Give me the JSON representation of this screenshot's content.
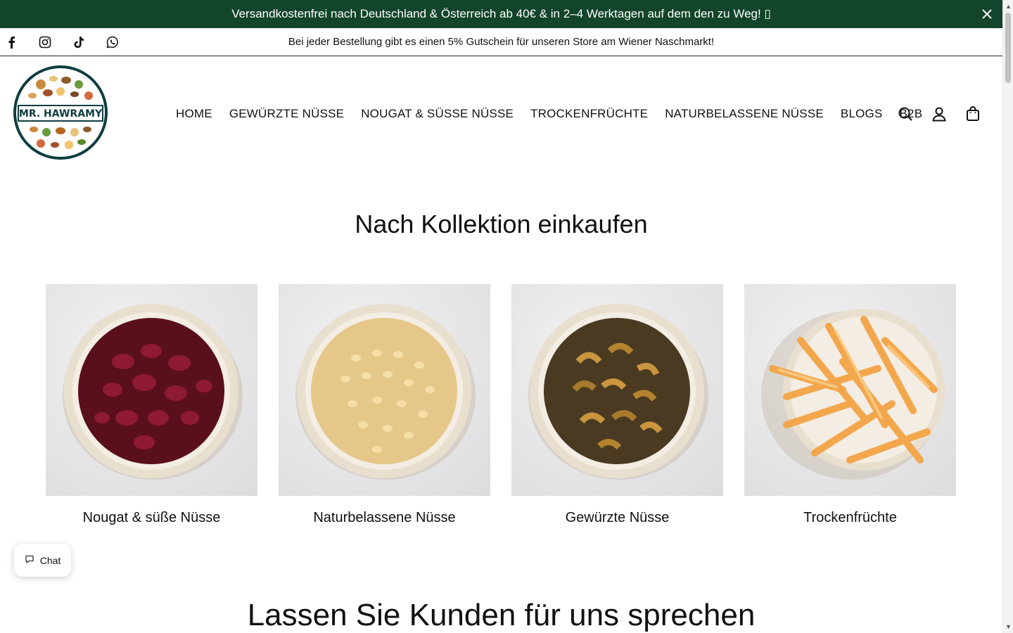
{
  "announcement": {
    "text": "Versandkostenfrei nach Deutschland & Österreich ab 40€ & in 2–4 Werktagen auf dem den zu Weg! ",
    "emoji_box": "▯",
    "close_icon": "close-icon"
  },
  "subbar": {
    "promo": "Bei jeder Bestellung gibt es einen 5% Gutschein für unseren Store am Wiener Naschmarkt!",
    "socials": [
      "facebook-icon",
      "instagram-icon",
      "tiktok-icon",
      "whatsapp-icon"
    ]
  },
  "header": {
    "logo_text": "MR. HAWRAMY",
    "nav": [
      "HOME",
      "GEWÜRZTE NÜSSE",
      "NOUGAT & SÜSSE NÜSSE",
      "TROCKENFRÜCHTE",
      "NATURBELASSENE NÜSSE",
      "BLOGS",
      "B2B"
    ],
    "icons": [
      "search-icon",
      "account-icon",
      "cart-icon"
    ]
  },
  "collections": {
    "title": "Nach Kollektion einkaufen",
    "items": [
      {
        "label": "Nougat & süße Nüsse"
      },
      {
        "label": "Naturbelassene Nüsse"
      },
      {
        "label": "Gewürzte Nüsse"
      },
      {
        "label": "Trockenfrüchte"
      }
    ]
  },
  "testimonials": {
    "title": "Lassen Sie Kunden für uns sprechen"
  },
  "chat": {
    "label": "Chat"
  },
  "colors": {
    "announcement_bg": "#12452b",
    "logo_ring": "#0f3d40"
  }
}
